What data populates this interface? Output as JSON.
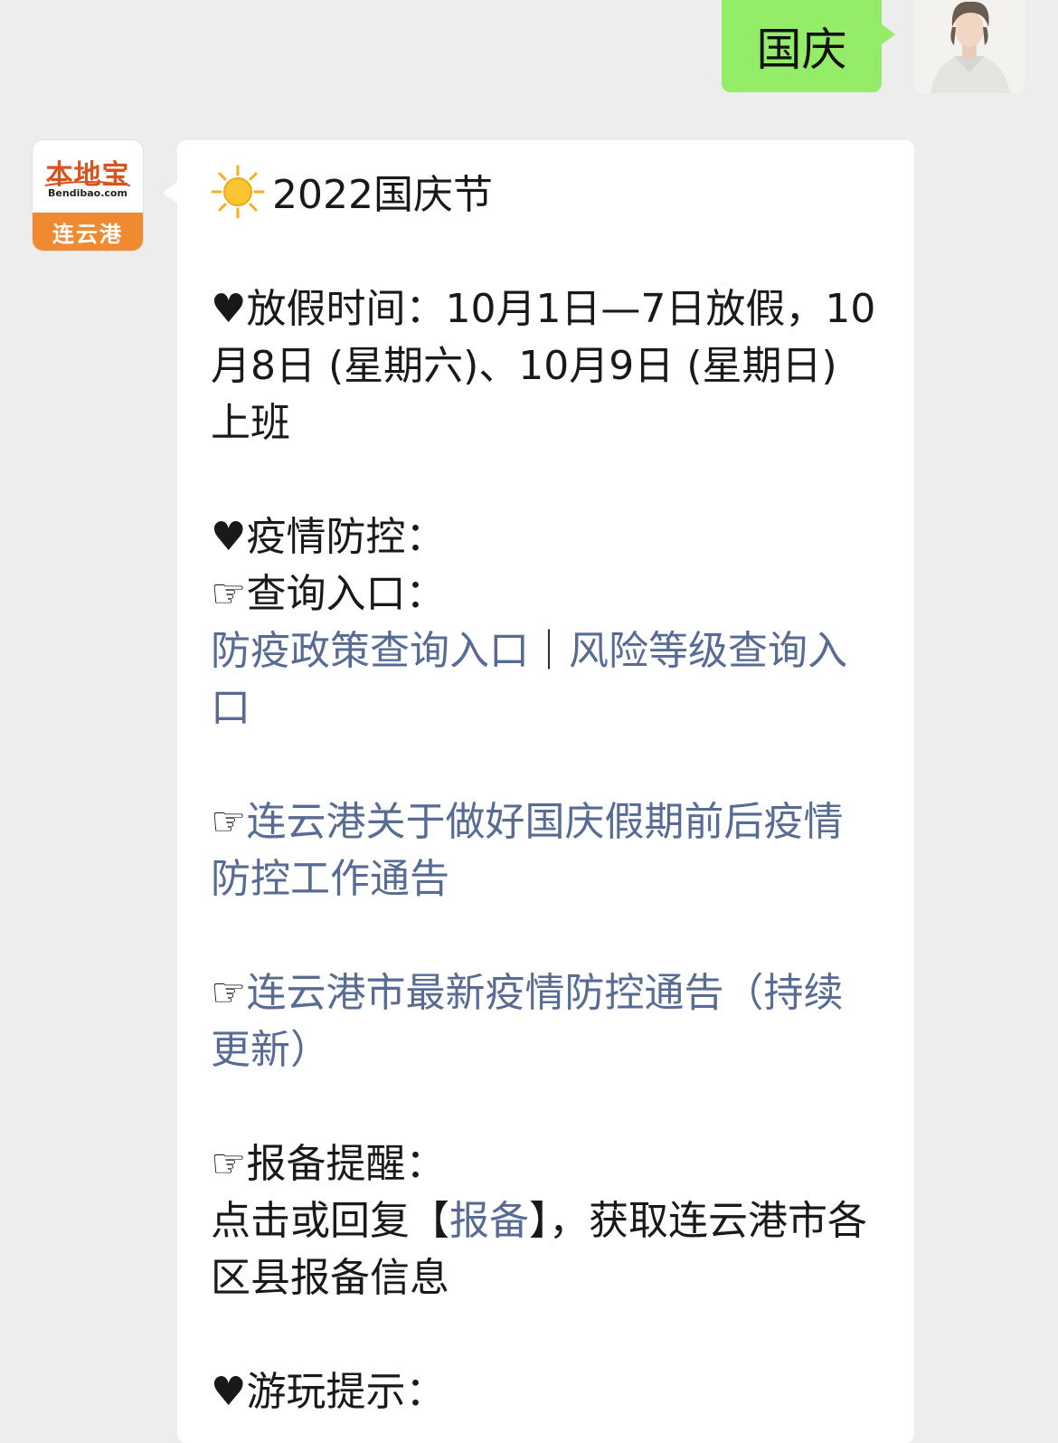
{
  "outgoing": {
    "text": "国庆"
  },
  "account": {
    "logo_text": "本地宝",
    "domain_text": "Bendibao.com",
    "city": "连云港"
  },
  "message": {
    "title": "2022国庆节",
    "heart_icon": "♥",
    "hand_icon": "☞",
    "holiday_label": "放假时间：",
    "holiday_text": "10月1日—7日放假，10月8日 (星期六)、10月9日 (星期日) 上班",
    "epidemic_label": "疫情防控：",
    "query_label": "查询入口：",
    "link_policy": "防疫政策查询入口",
    "separator": "｜",
    "link_risk": "风险等级查询入口",
    "link_notice": "连云港关于做好国庆假期前后疫情防控工作通告",
    "link_latest": "连云港市最新疫情防控通告（持续更新）",
    "report_label": "报备提醒：",
    "report_prefix": "点击或回复【",
    "report_keyword": "报备",
    "report_suffix": "】，获取连云港市各区县报备信息",
    "travel_label": "游玩提示："
  },
  "colors": {
    "outgoing_bubble": "#95ec69",
    "link": "#576b95",
    "background": "#ededed",
    "brand_orange": "#f08a31"
  }
}
